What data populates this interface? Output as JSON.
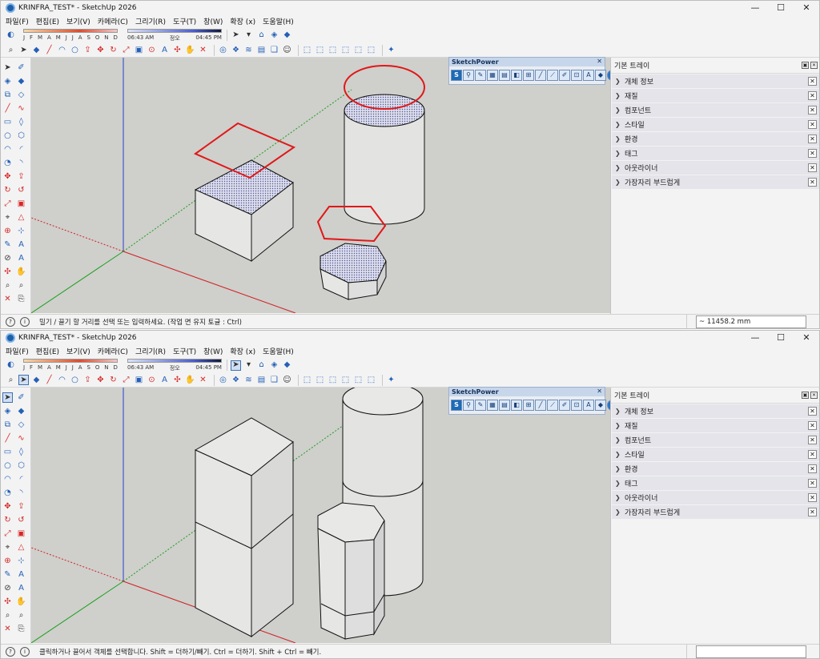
{
  "windows": [
    {
      "title": "KRINFRA_TEST* - SketchUp 2026",
      "menus": [
        "파일(F)",
        "편집(E)",
        "보기(V)",
        "카메라(C)",
        "그리기(R)",
        "도구(T)",
        "창(W)",
        "확장 (x)",
        "도움말(H)"
      ],
      "shadow": {
        "months": [
          "J",
          "F",
          "M",
          "A",
          "M",
          "J",
          "J",
          "A",
          "S",
          "O",
          "N",
          "D"
        ],
        "time_start": "06:43 AM",
        "time_mid": "정오",
        "time_end": "04:45 PM"
      },
      "sketchpower": {
        "title": "SketchPower",
        "close": "✕"
      },
      "tray": {
        "title": "기본 트레이",
        "items": [
          "개체 정보",
          "재질",
          "컴포넌트",
          "스타일",
          "환경",
          "태그",
          "아웃라이너",
          "가장자리 부드럽게"
        ]
      },
      "status": {
        "text": "밀기 / 끌기 할 거리를 선택 또는 입력하세요. (작업 면 유지 토글 : Ctrl)",
        "measurement": "~ 11458.2 mm"
      }
    },
    {
      "title": "KRINFRA_TEST* - SketchUp 2026",
      "menus": [
        "파일(F)",
        "편집(E)",
        "보기(V)",
        "카메라(C)",
        "그리기(R)",
        "도구(T)",
        "창(W)",
        "확장 (x)",
        "도움말(H)"
      ],
      "shadow": {
        "months": [
          "J",
          "F",
          "M",
          "A",
          "M",
          "J",
          "J",
          "A",
          "S",
          "O",
          "N",
          "D"
        ],
        "time_start": "06:43 AM",
        "time_mid": "정오",
        "time_end": "04:45 PM"
      },
      "sketchpower": {
        "title": "SketchPower",
        "close": "✕"
      },
      "tray": {
        "title": "기본 트레이",
        "items": [
          "개체 정보",
          "재질",
          "컴포넌트",
          "스타일",
          "환경",
          "태그",
          "아웃라이너",
          "가장자리 부드럽게"
        ]
      },
      "status": {
        "text": "클릭하거나 끌어서 객체를 선택합니다. Shift = 더하기/빼기. Ctrl = 더하기. Shift + Ctrl = 빼기.",
        "measurement": ""
      }
    }
  ],
  "window_controls": {
    "minimize": "—",
    "maximize": "☐",
    "close": "✕"
  },
  "colors": {
    "accent_red": "#e01818",
    "axis_blue": "#2a3fd0",
    "axis_green": "#18a018",
    "axis_red": "#d02020",
    "tray_item_bg": "#e4e4ea"
  }
}
